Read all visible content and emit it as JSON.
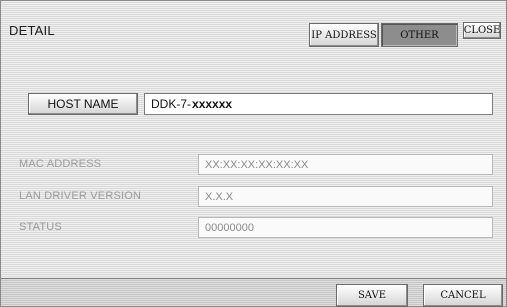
{
  "header": {
    "title": "DETAIL",
    "tabs": [
      {
        "label": "IP ADDRESS",
        "selected": false
      },
      {
        "label": "OTHER",
        "selected": true
      }
    ],
    "close_label": "CLOSE"
  },
  "host": {
    "button_label": "HOST NAME",
    "prefix": "DDK-7- ",
    "value": "xxxxxx"
  },
  "info": [
    {
      "label": "MAC ADDRESS",
      "value": "XX:XX:XX:XX:XX:XX"
    },
    {
      "label": "LAN DRIVER VERSION",
      "value": "X.X.X"
    },
    {
      "label": "STATUS",
      "value": "00000000"
    }
  ],
  "footer": {
    "save_label": "SAVE",
    "cancel_label": "CANCEL"
  }
}
